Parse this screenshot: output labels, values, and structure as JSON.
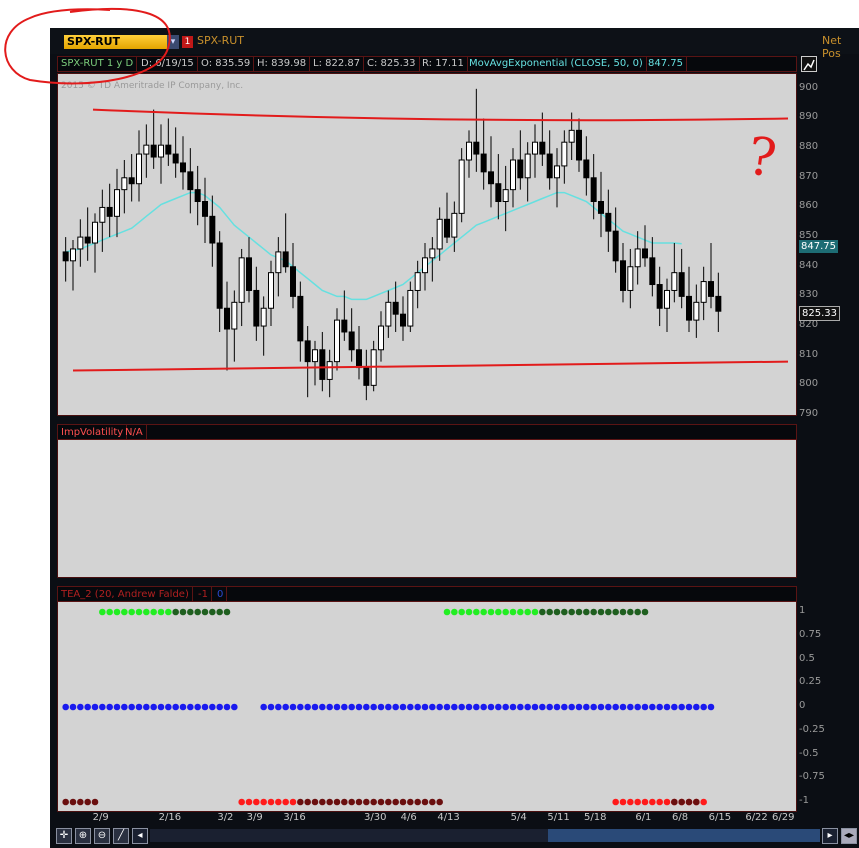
{
  "header": {
    "symbol": "SPX-RUT",
    "symbol_label": "SPX-RUT",
    "net_pos": "Net Pos"
  },
  "infobar": {
    "study": "SPX-RUT 1 y D",
    "date": "D: 6/19/15",
    "open": "O: 835.59",
    "high": "H: 839.98",
    "low": "L: 822.87",
    "close": "C: 825.33",
    "range": "R: 17.11",
    "ma_label": "MovAvgExponential (CLOSE, 50, 0)",
    "ma_value": "847.75"
  },
  "copyright": "2015 © TD Ameritrade IP Company, Inc.",
  "colors": {
    "panel_bg": "#d3d3d3",
    "candle": "#000000",
    "ema": "#66e0e0",
    "annotation": "#e21b1b",
    "dot_green": "#22ee22",
    "dot_dark_green": "#1f5f1f",
    "dot_blue": "#1a1aee",
    "dot_red": "#ff1a1a",
    "dot_dark_red": "#6a0f0f"
  },
  "price_axis": {
    "ticks": [
      "900",
      "890",
      "880",
      "870",
      "860",
      "850",
      "840",
      "830",
      "820",
      "810",
      "800",
      "790"
    ],
    "current_price": "825.33",
    "ema_value": "847.75"
  },
  "imp_vol": {
    "label": "ImpVolatility",
    "value": "N/A"
  },
  "tea": {
    "label": "TEA_2 (20, Andrew Falde)",
    "v1": "-1",
    "v2": "0",
    "ticks": [
      "1",
      "0.75",
      "0.5",
      "0.25",
      "0",
      "-0.25",
      "-0.5",
      "-0.75",
      "-1"
    ]
  },
  "x_axis": {
    "labels": [
      "2/9",
      "2/16",
      "3/2",
      "3/9",
      "3/16",
      "3/30",
      "4/6",
      "4/13",
      "5/4",
      "5/11",
      "5/18",
      "6/1",
      "6/8",
      "6/15",
      "6/22",
      "6/29"
    ]
  },
  "annotation_text": "?",
  "chart_data": {
    "type": "candlestick",
    "title": "SPX-RUT 1 y D",
    "ylim": [
      790,
      905
    ],
    "candles": [
      [
        845,
        850,
        835,
        842
      ],
      [
        842,
        849,
        832,
        846
      ],
      [
        846,
        856,
        840,
        850
      ],
      [
        850,
        860,
        842,
        848
      ],
      [
        848,
        858,
        838,
        855
      ],
      [
        855,
        866,
        845,
        860
      ],
      [
        860,
        868,
        850,
        857
      ],
      [
        857,
        873,
        850,
        866
      ],
      [
        866,
        876,
        858,
        870
      ],
      [
        870,
        878,
        862,
        868
      ],
      [
        868,
        886,
        862,
        878
      ],
      [
        878,
        888,
        870,
        881
      ],
      [
        881,
        893,
        873,
        877
      ],
      [
        877,
        888,
        868,
        881
      ],
      [
        881,
        890,
        874,
        878
      ],
      [
        878,
        887,
        870,
        875
      ],
      [
        875,
        884,
        866,
        872
      ],
      [
        872,
        880,
        858,
        866
      ],
      [
        866,
        874,
        854,
        862
      ],
      [
        862,
        870,
        848,
        857
      ],
      [
        857,
        864,
        840,
        848
      ],
      [
        848,
        852,
        818,
        826
      ],
      [
        826,
        835,
        805,
        819
      ],
      [
        819,
        832,
        808,
        828
      ],
      [
        828,
        846,
        820,
        843
      ],
      [
        843,
        850,
        828,
        832
      ],
      [
        832,
        840,
        815,
        820
      ],
      [
        820,
        830,
        810,
        826
      ],
      [
        826,
        842,
        820,
        838
      ],
      [
        838,
        850,
        830,
        845
      ],
      [
        845,
        858,
        838,
        840
      ],
      [
        840,
        848,
        826,
        830
      ],
      [
        830,
        835,
        808,
        815
      ],
      [
        815,
        820,
        796,
        808
      ],
      [
        808,
        815,
        800,
        812
      ],
      [
        812,
        818,
        798,
        802
      ],
      [
        802,
        812,
        796,
        808
      ],
      [
        808,
        826,
        805,
        822
      ],
      [
        822,
        832,
        815,
        818
      ],
      [
        818,
        826,
        808,
        812
      ],
      [
        812,
        820,
        802,
        806
      ],
      [
        806,
        812,
        795,
        800
      ],
      [
        800,
        815,
        798,
        812
      ],
      [
        812,
        825,
        808,
        820
      ],
      [
        820,
        832,
        816,
        828
      ],
      [
        828,
        835,
        818,
        824
      ],
      [
        824,
        830,
        815,
        820
      ],
      [
        820,
        835,
        818,
        832
      ],
      [
        832,
        842,
        826,
        838
      ],
      [
        838,
        848,
        832,
        843
      ],
      [
        843,
        850,
        835,
        846
      ],
      [
        846,
        860,
        842,
        856
      ],
      [
        856,
        865,
        848,
        850
      ],
      [
        850,
        862,
        845,
        858
      ],
      [
        858,
        880,
        855,
        876
      ],
      [
        876,
        886,
        870,
        882
      ],
      [
        882,
        900,
        872,
        878
      ],
      [
        878,
        890,
        866,
        872
      ],
      [
        872,
        884,
        860,
        868
      ],
      [
        868,
        878,
        856,
        862
      ],
      [
        862,
        874,
        852,
        866
      ],
      [
        866,
        880,
        860,
        876
      ],
      [
        876,
        886,
        866,
        870
      ],
      [
        870,
        882,
        862,
        878
      ],
      [
        878,
        888,
        870,
        882
      ],
      [
        882,
        892,
        874,
        878
      ],
      [
        878,
        886,
        866,
        870
      ],
      [
        870,
        880,
        860,
        874
      ],
      [
        874,
        886,
        868,
        882
      ],
      [
        882,
        892,
        876,
        886
      ],
      [
        886,
        890,
        872,
        876
      ],
      [
        876,
        884,
        864,
        870
      ],
      [
        870,
        878,
        856,
        862
      ],
      [
        862,
        872,
        850,
        858
      ],
      [
        858,
        866,
        845,
        852
      ],
      [
        852,
        860,
        838,
        842
      ],
      [
        842,
        848,
        828,
        832
      ],
      [
        832,
        846,
        826,
        840
      ],
      [
        840,
        852,
        834,
        846
      ],
      [
        846,
        854,
        840,
        843
      ],
      [
        843,
        850,
        830,
        834
      ],
      [
        834,
        840,
        820,
        826
      ],
      [
        826,
        836,
        818,
        832
      ],
      [
        832,
        848,
        828,
        838
      ],
      [
        838,
        846,
        826,
        830
      ],
      [
        830,
        840,
        818,
        822
      ],
      [
        822,
        834,
        816,
        828
      ],
      [
        828,
        840,
        822,
        835
      ],
      [
        835,
        848,
        826,
        830
      ],
      [
        830,
        838,
        818,
        825
      ]
    ],
    "ema": [
      845,
      845.5,
      846,
      847,
      848,
      849,
      850,
      851,
      852,
      853,
      855,
      857,
      859,
      861,
      862,
      863,
      864,
      865,
      865,
      864,
      862,
      860,
      857,
      854,
      852,
      850,
      848,
      846,
      844,
      843,
      842,
      840,
      838,
      836,
      834,
      832,
      831,
      830,
      830,
      829,
      829,
      829,
      830,
      831,
      832,
      833,
      834,
      836,
      838,
      840,
      842,
      844,
      846,
      848,
      850,
      852,
      854,
      855,
      856,
      857,
      858,
      859,
      860,
      861,
      862,
      863,
      864,
      865,
      865,
      864,
      863,
      862,
      860,
      858,
      856,
      854,
      852,
      851,
      850,
      849,
      848,
      848,
      848,
      848,
      847.75
    ],
    "resistance_line": [
      [
        0,
        893
      ],
      [
        1,
        890
      ]
    ],
    "support_line": [
      [
        0,
        805
      ],
      [
        1,
        808
      ]
    ],
    "tea": {
      "top": [
        {
          "start": 5,
          "count": 10,
          "color": "green"
        },
        {
          "start": 15,
          "count": 8,
          "color": "dark_green"
        },
        {
          "start": 52,
          "count": 13,
          "color": "green"
        },
        {
          "start": 65,
          "count": 15,
          "color": "dark_green"
        }
      ],
      "zero": [
        {
          "start": 0,
          "count": 24
        },
        {
          "start": 27,
          "count": 62
        }
      ],
      "bottom": [
        {
          "start": 0,
          "count": 5,
          "color": "dark_red"
        },
        {
          "start": 24,
          "count": 8,
          "color": "red"
        },
        {
          "start": 32,
          "count": 20,
          "color": "dark_red"
        },
        {
          "start": 75,
          "count": 13,
          "color": "red"
        },
        {
          "start": 83,
          "count": 4,
          "color": "dark_red"
        }
      ]
    }
  }
}
